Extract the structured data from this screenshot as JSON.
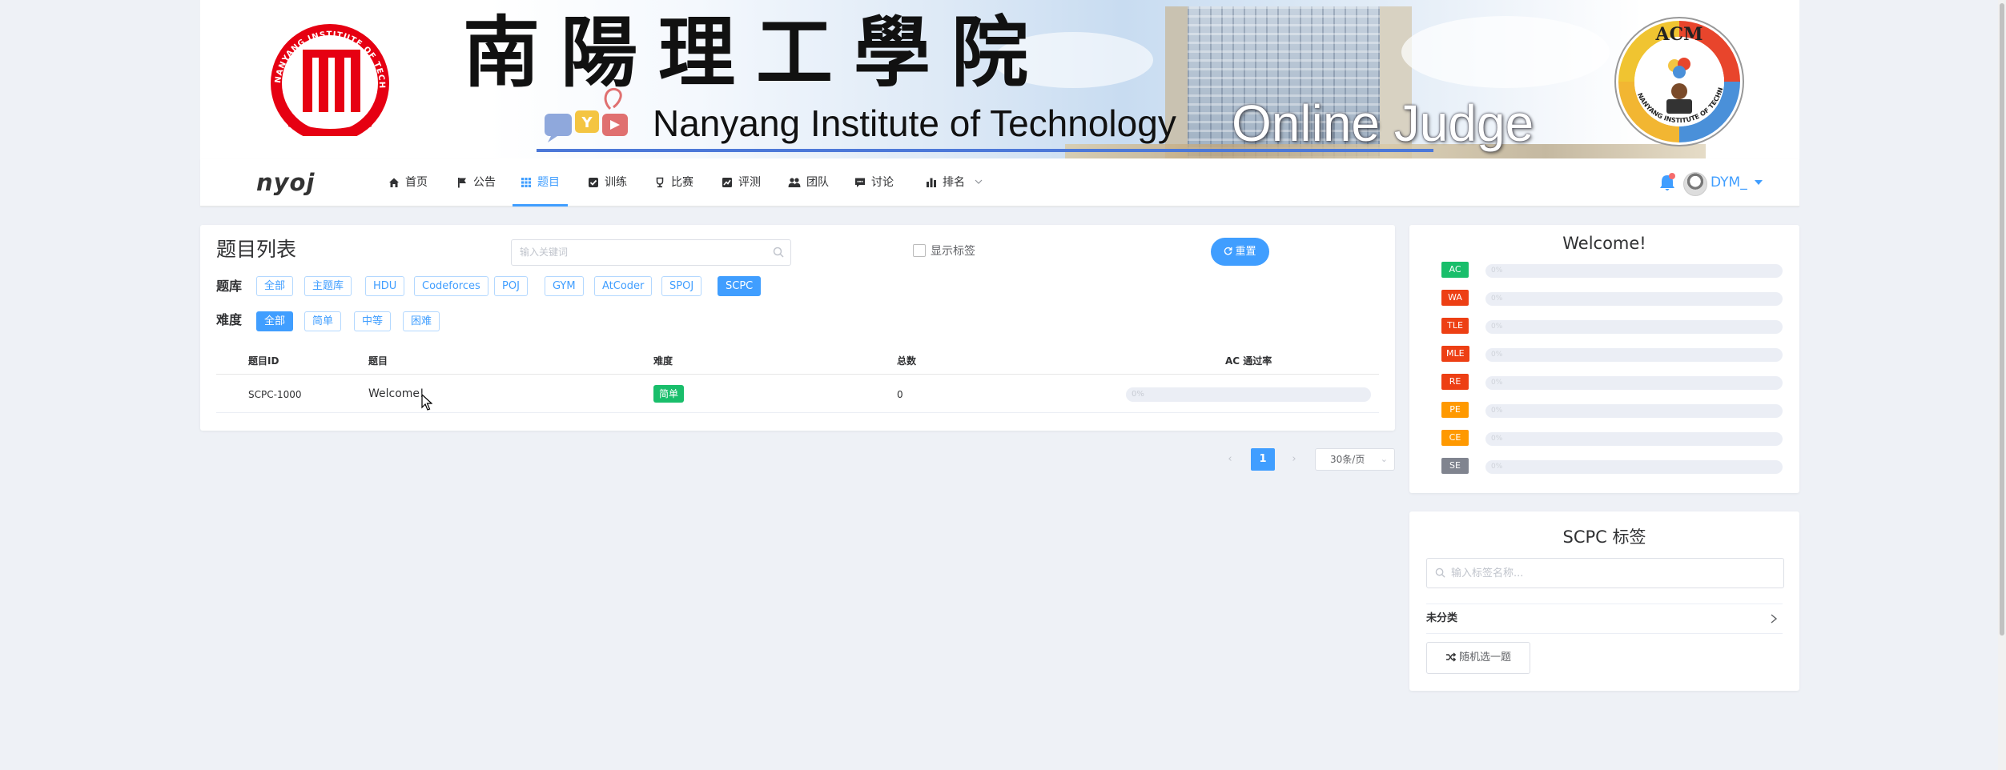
{
  "banner": {
    "calligraphy": "南陽理工學院",
    "english_name": "Nanyang Institute of Technology",
    "oj_title": "Online Judge",
    "left_logo_text": "NANYANG INSTITUTE OF TECHNOLOGY",
    "acm_text": "ACM",
    "acm_ring_text": "NANYANG INSTITUTE OF TECHNOLOGY"
  },
  "navbar": {
    "brand": "nyoj",
    "items": [
      {
        "label": "首页",
        "icon": "home-icon"
      },
      {
        "label": "公告",
        "icon": "flag-icon"
      },
      {
        "label": "题目",
        "icon": "grid-icon",
        "active": true
      },
      {
        "label": "训练",
        "icon": "checkbox-icon"
      },
      {
        "label": "比赛",
        "icon": "trophy-icon"
      },
      {
        "label": "评测",
        "icon": "chart-box-icon"
      },
      {
        "label": "团队",
        "icon": "users-icon"
      },
      {
        "label": "讨论",
        "icon": "comment-icon"
      },
      {
        "label": "排名",
        "icon": "bar-chart-icon",
        "has_dropdown": true
      }
    ],
    "username": "DYM_",
    "colors": {
      "accent": "#409eff",
      "notification_dot": "#f56c6c"
    }
  },
  "problem_list": {
    "title": "题目列表",
    "search_placeholder": "输入关键词",
    "show_tags_label": "显示标签",
    "reset_label": "重置",
    "oj_label": "题库",
    "oj_options": [
      "全部",
      "主题库",
      "HDU",
      "Codeforces",
      "POJ",
      "GYM",
      "AtCoder",
      "SPOJ",
      "SCPC"
    ],
    "oj_selected": "SCPC",
    "difficulty_label": "难度",
    "difficulty_options": [
      "全部",
      "简单",
      "中等",
      "困难"
    ],
    "difficulty_selected": "全部",
    "columns": [
      "题目ID",
      "题目",
      "难度",
      "总数",
      "AC 通过率"
    ],
    "rows": [
      {
        "id": "SCPC-1000",
        "title": "Welcome!",
        "difficulty": "简单",
        "total": "0",
        "ac_rate_text": "0%",
        "ac_rate": 0
      }
    ]
  },
  "pagination": {
    "prev": "‹",
    "current": "1",
    "next": "›",
    "page_size": "30条/页"
  },
  "welcome": {
    "title": "Welcome!",
    "statuses": [
      {
        "code": "AC",
        "color": "#19be6b",
        "value": "0%"
      },
      {
        "code": "WA",
        "color": "#ed3f14",
        "value": "0%"
      },
      {
        "code": "TLE",
        "color": "#ed3f14",
        "value": "0%"
      },
      {
        "code": "MLE",
        "color": "#ed3f14",
        "value": "0%"
      },
      {
        "code": "RE",
        "color": "#ed3f14",
        "value": "0%"
      },
      {
        "code": "PE",
        "color": "#ff9900",
        "value": "0%"
      },
      {
        "code": "CE",
        "color": "#ff9900",
        "value": "0%"
      },
      {
        "code": "SE",
        "color": "#80848f",
        "value": "0%"
      }
    ]
  },
  "tags_panel": {
    "title": "SCPC 标签",
    "search_placeholder": "输入标签名称...",
    "category": "未分类",
    "random_label": "随机选一题"
  }
}
